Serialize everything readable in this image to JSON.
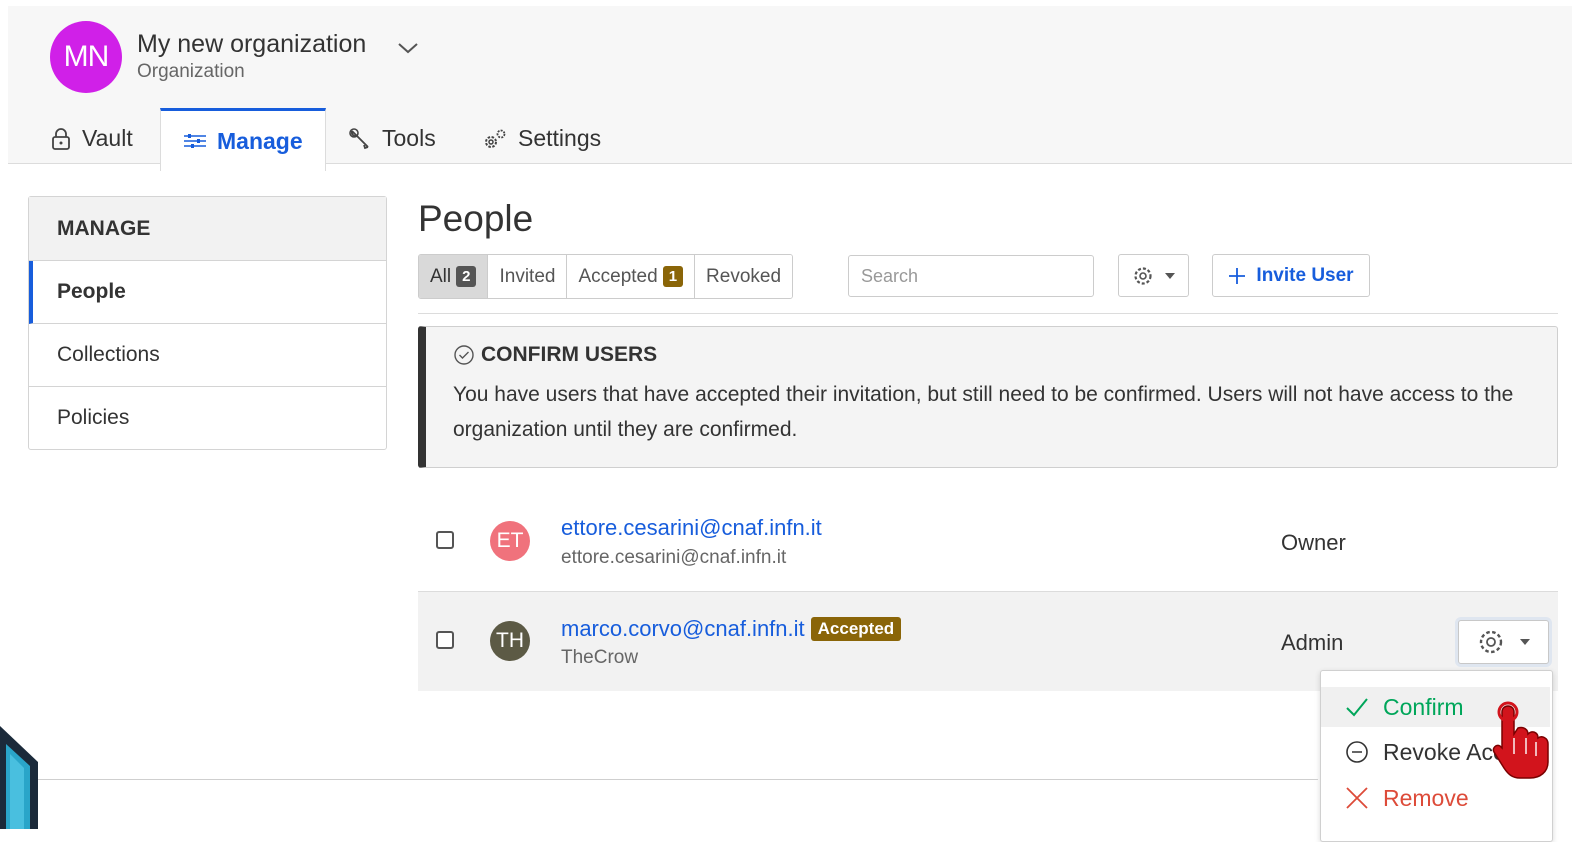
{
  "org": {
    "initials": "MN",
    "name": "My new organization",
    "subtitle": "Organization"
  },
  "tabs": [
    {
      "label": "Vault",
      "icon": "lock-icon"
    },
    {
      "label": "Manage",
      "icon": "sliders-icon",
      "active": true
    },
    {
      "label": "Tools",
      "icon": "wrench-icon"
    },
    {
      "label": "Settings",
      "icon": "cogs-icon"
    }
  ],
  "sidebar": {
    "heading": "MANAGE",
    "items": [
      {
        "label": "People",
        "active": true
      },
      {
        "label": "Collections"
      },
      {
        "label": "Policies"
      }
    ]
  },
  "main": {
    "title": "People",
    "filters": [
      {
        "label": "All",
        "count": "2",
        "active": true
      },
      {
        "label": "Invited"
      },
      {
        "label": "Accepted",
        "count": "1"
      },
      {
        "label": "Revoked"
      }
    ],
    "search_placeholder": "Search",
    "invite_label": "Invite User",
    "callout": {
      "title": "CONFIRM USERS",
      "body": "You have users that have accepted their invitation, but still need to be confirmed. Users will not have access to the organization until they are confirmed."
    },
    "users": [
      {
        "initials": "ET",
        "avatar_color": "#f0727c",
        "email": "ettore.cesarini@cnaf.infn.it",
        "name": "ettore.cesarini@cnaf.infn.it",
        "role": "Owner"
      },
      {
        "initials": "TH",
        "avatar_color": "#5c5a45",
        "email": "marco.corvo@cnaf.infn.it",
        "status": "Accepted",
        "name": "TheCrow",
        "role": "Admin"
      }
    ]
  },
  "menu": {
    "confirm": "Confirm",
    "revoke": "Revoke Access",
    "remove": "Remove"
  },
  "colors": {
    "primary": "#175ddc",
    "success": "#00a65a",
    "danger": "#dd4b39",
    "warning_badge": "#8a6508",
    "org_avatar": "#d020e8"
  }
}
